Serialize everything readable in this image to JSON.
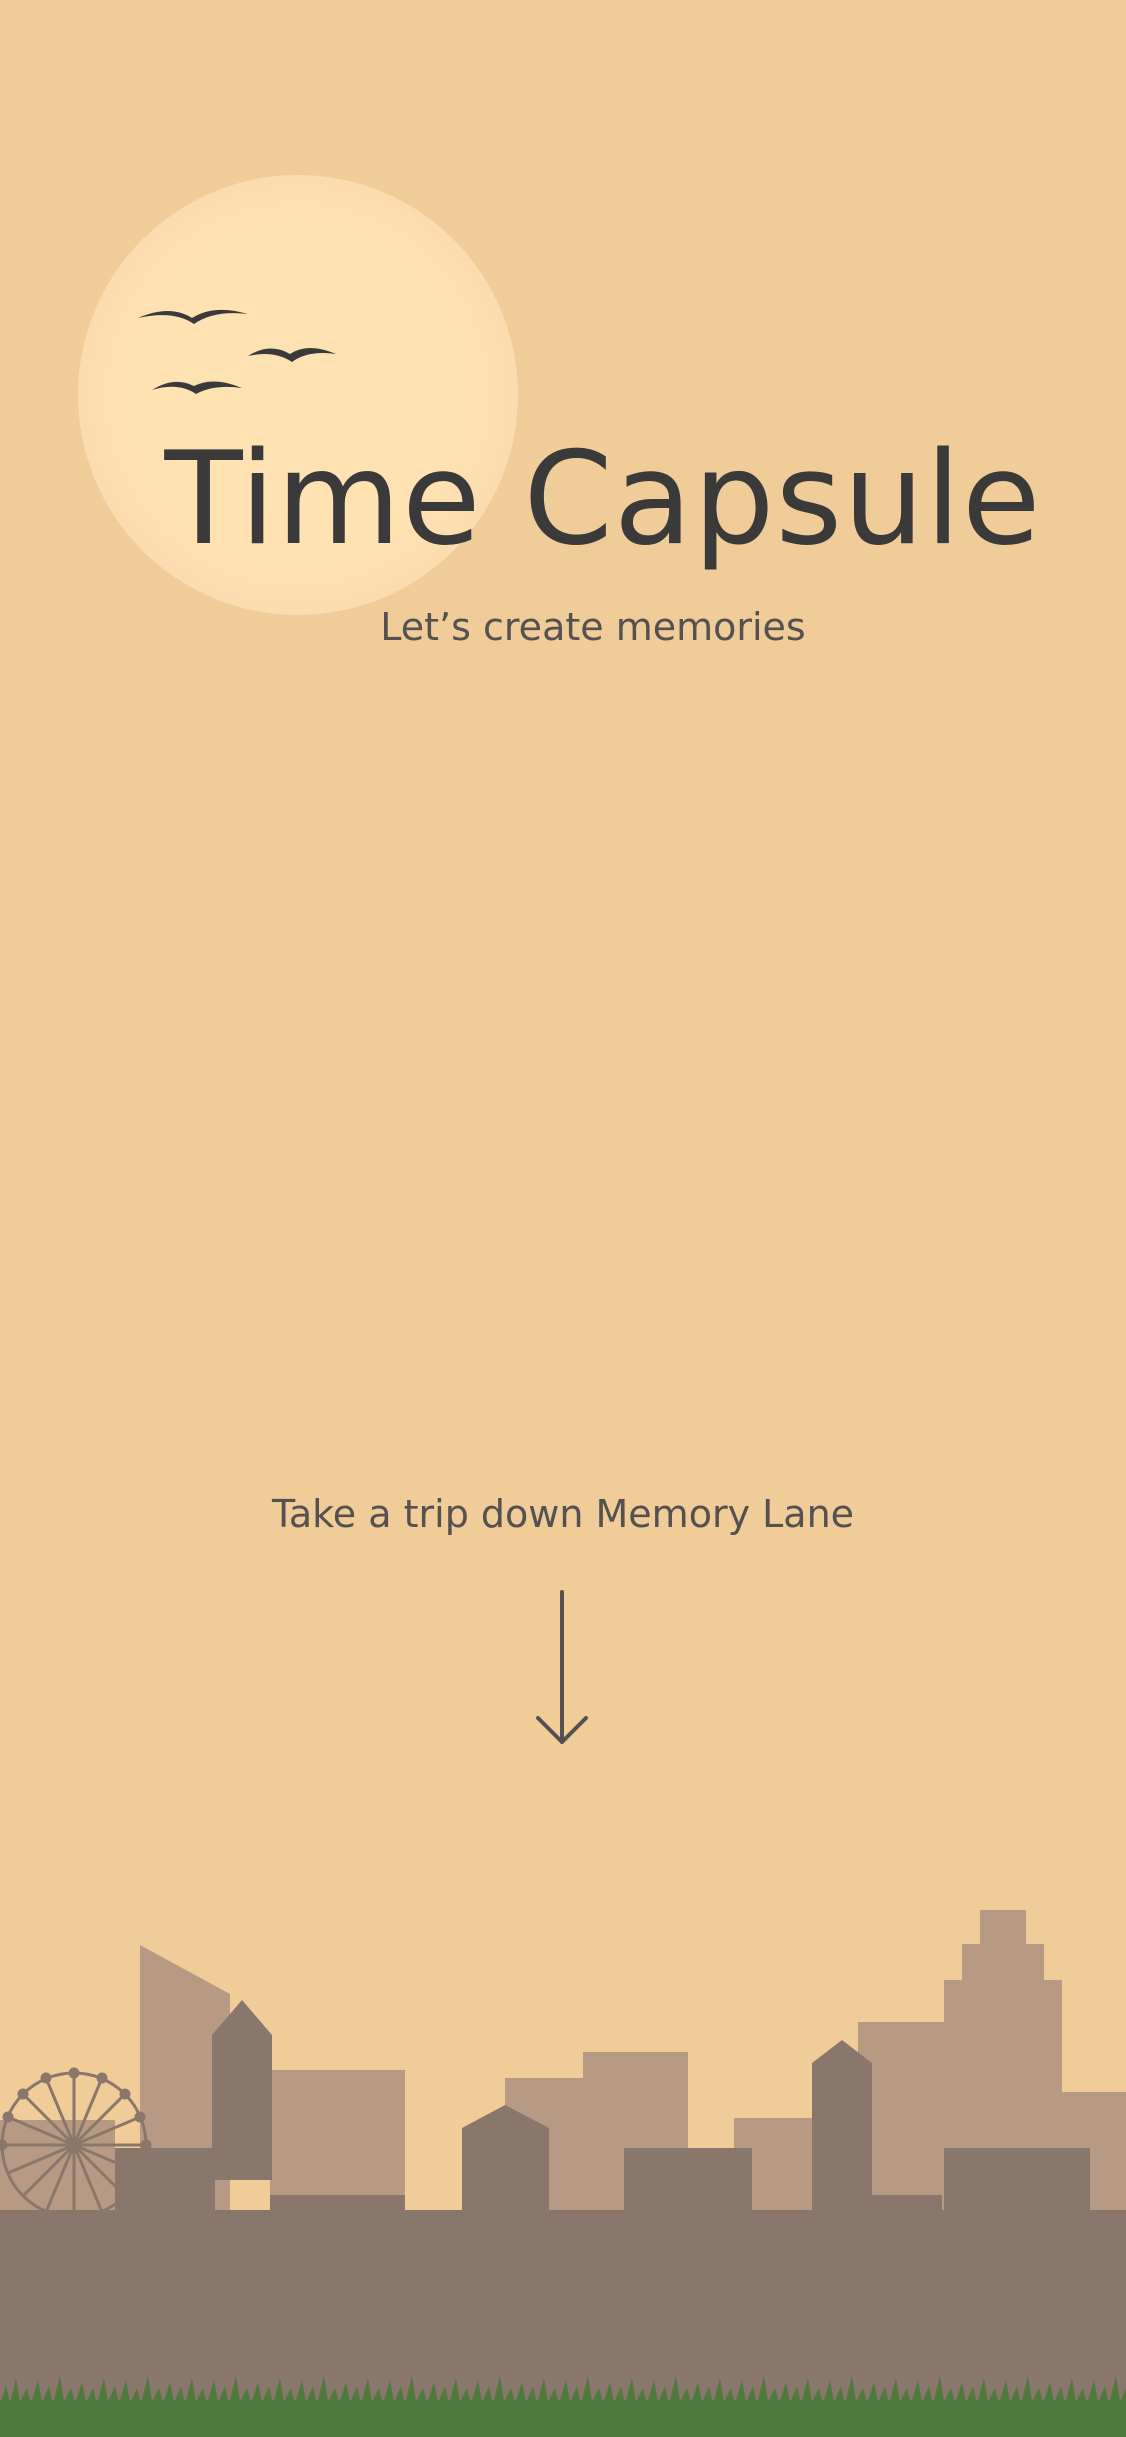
{
  "app": {
    "title": "Time Capsule",
    "subtitle": "Let’s create memories"
  },
  "cta": {
    "text": "Take a trip down Memory Lane",
    "arrow_icon": "arrow-down-icon"
  },
  "colors": {
    "background": "#f0cd98",
    "sun": "#ffe1b2",
    "text_dark": "#3b3a3a",
    "text_muted": "#555151",
    "building_back": "#b69a83",
    "building_front": "#8a776b",
    "grass": "#4e7a3d"
  }
}
